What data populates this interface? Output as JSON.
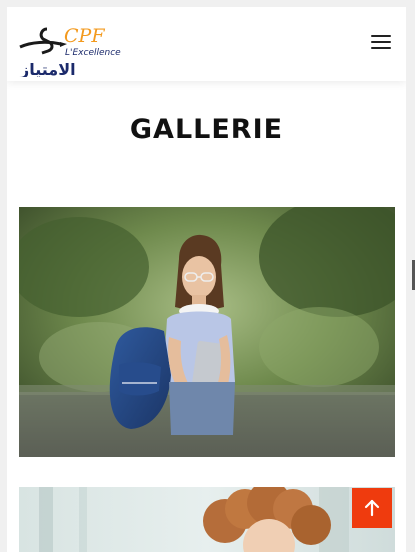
{
  "header": {
    "logo": {
      "latin_text": "CPF",
      "subtitle": "L'Excellence",
      "arabic_text": "الامتياز"
    },
    "menu_icon": "hamburger-menu-icon"
  },
  "main": {
    "title": "GALLERIE",
    "gallery": [
      {
        "alt": "student-with-backpack-photo"
      },
      {
        "alt": "curly-haired-woman-photo"
      }
    ]
  },
  "scroll_top_icon": "arrow-up-icon",
  "colors": {
    "accent": "#ef3b0e",
    "logo_orange": "#f39a1e",
    "logo_navy": "#1b2a6b",
    "logo_black": "#1a1a1a"
  }
}
